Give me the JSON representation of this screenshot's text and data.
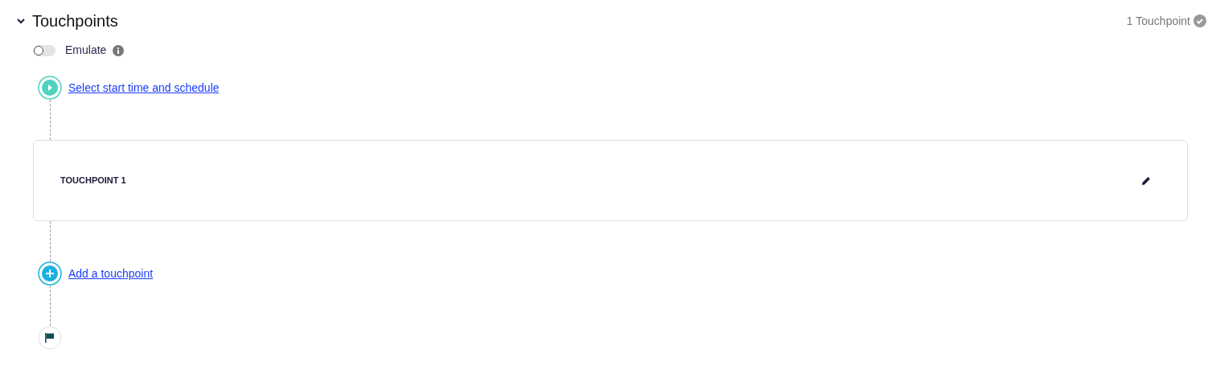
{
  "section": {
    "title": "Touchpoints",
    "expanded": true,
    "summary": "1 Touchpoint",
    "complete": true
  },
  "emulate": {
    "label": "Emulate",
    "on": false
  },
  "start": {
    "link": "Select start time and schedule"
  },
  "touchpoints": [
    {
      "title": "TOUCHPOINT 1"
    }
  ],
  "add": {
    "link": "Add a touchpoint"
  }
}
